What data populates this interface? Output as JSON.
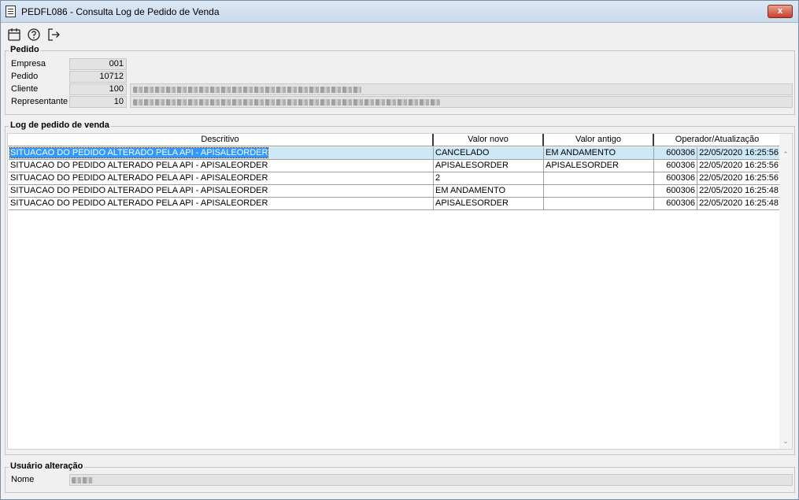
{
  "window": {
    "title": "PEDFL086 - Consulta Log de Pedido de Venda",
    "close_label": "x"
  },
  "toolbar": {
    "icons": [
      "calendar-icon",
      "help-icon",
      "exit-icon"
    ]
  },
  "pedido": {
    "title": "Pedido",
    "empresa_label": "Empresa",
    "empresa_value": "001",
    "pedido_label": "Pedido",
    "pedido_value": "10712",
    "cliente_label": "Cliente",
    "cliente_value": "100",
    "representante_label": "Representante",
    "representante_value": "10"
  },
  "log": {
    "title": "Log de pedido de venda",
    "columns": [
      "Descritivo",
      "Valor novo",
      "Valor antigo",
      "Operador/Atualização"
    ],
    "rows": [
      {
        "descritivo": "SITUACAO DO PEDIDO ALTERADO PELA API - APISALEORDER",
        "valor_novo": "CANCELADO",
        "valor_antigo": "EM ANDAMENTO",
        "operador": "600306",
        "atualizacao": "22/05/2020 16:25:56"
      },
      {
        "descritivo": "SITUACAO DO PEDIDO ALTERADO PELA API - APISALEORDER",
        "valor_novo": "APISALESORDER",
        "valor_antigo": "APISALESORDER",
        "operador": "600306",
        "atualizacao": "22/05/2020 16:25:56"
      },
      {
        "descritivo": "SITUACAO DO PEDIDO ALTERADO PELA API - APISALEORDER",
        "valor_novo": "2",
        "valor_antigo": "",
        "operador": "600306",
        "atualizacao": "22/05/2020 16:25:56"
      },
      {
        "descritivo": "SITUACAO DO PEDIDO ALTERADO PELA API - APISALEORDER",
        "valor_novo": "EM ANDAMENTO",
        "valor_antigo": "",
        "operador": "600306",
        "atualizacao": "22/05/2020 16:25:48"
      },
      {
        "descritivo": "SITUACAO DO PEDIDO ALTERADO PELA API - APISALEORDER",
        "valor_novo": "APISALESORDER",
        "valor_antigo": "",
        "operador": "600306",
        "atualizacao": "22/05/2020 16:25:48"
      }
    ]
  },
  "usuario": {
    "title": "Usuário alteração",
    "nome_label": "Nome"
  },
  "colors": {
    "selected_row": "#cde8f7",
    "selected_text_bg": "#3399ff",
    "close_button": "#c7402b"
  }
}
